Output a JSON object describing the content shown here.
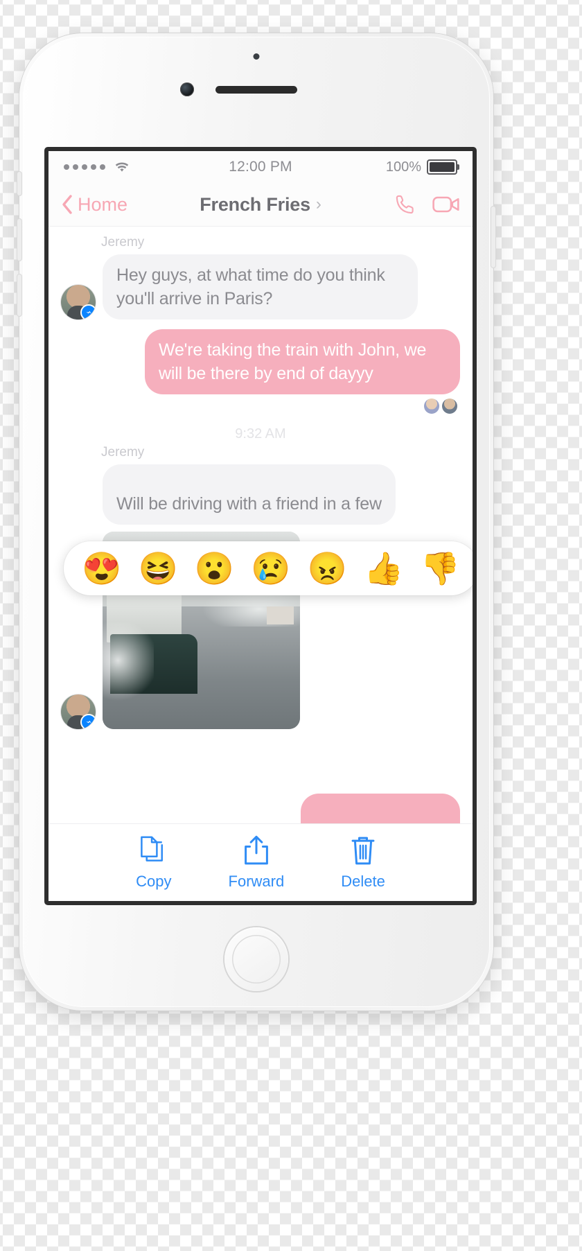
{
  "status_bar": {
    "signal_dots": 5,
    "wifi_icon": "wifi-icon",
    "time": "12:00 PM",
    "battery_percent": "100%",
    "battery_icon": "battery-full-icon"
  },
  "nav_bar": {
    "back_icon": "chevron-left-icon",
    "back_label": "Home",
    "title": "French Fries",
    "title_chevron": "chevron-right-icon",
    "call_icon": "phone-icon",
    "video_icon": "video-camera-icon",
    "accent_color": "#f7a7b4",
    "title_color": "#6d6d72"
  },
  "thread": {
    "messages": [
      {
        "sender": "Jeremy",
        "direction": "in",
        "text": "Hey guys, at what time do you think you'll arrive in Paris?",
        "avatar_icon": "avatar-jeremy",
        "badge_icon": "messenger-badge-icon"
      },
      {
        "sender": "",
        "direction": "out",
        "text": "We're taking the train with John, we will be there by end of dayyy",
        "bubble_color": "#f6afbd"
      }
    ],
    "seen_label": "seen-avatars",
    "timestamp": "9:32 AM",
    "second_sender": "Jeremy",
    "hidden_message_text": "Will be driving with a friend in a few",
    "photo_alt": "frozen-river-boat-photo",
    "share_icon": "share-icon"
  },
  "reactions": {
    "emojis": [
      {
        "name": "heart-eyes-emoji",
        "glyph": "😍"
      },
      {
        "name": "laughing-emoji",
        "glyph": "😆"
      },
      {
        "name": "surprised-emoji",
        "glyph": "😮"
      },
      {
        "name": "crying-emoji",
        "glyph": "😢"
      },
      {
        "name": "angry-emoji",
        "glyph": "😠"
      },
      {
        "name": "thumbs-up-emoji",
        "glyph": "👍"
      },
      {
        "name": "thumbs-down-emoji",
        "glyph": "👎"
      }
    ]
  },
  "action_bar": {
    "accent_color": "#2f8cf5",
    "items": [
      {
        "name": "copy-action",
        "label": "Copy",
        "icon": "copy-icon"
      },
      {
        "name": "forward-action",
        "label": "Forward",
        "icon": "share-up-icon"
      },
      {
        "name": "delete-action",
        "label": "Delete",
        "icon": "trash-icon"
      }
    ]
  }
}
